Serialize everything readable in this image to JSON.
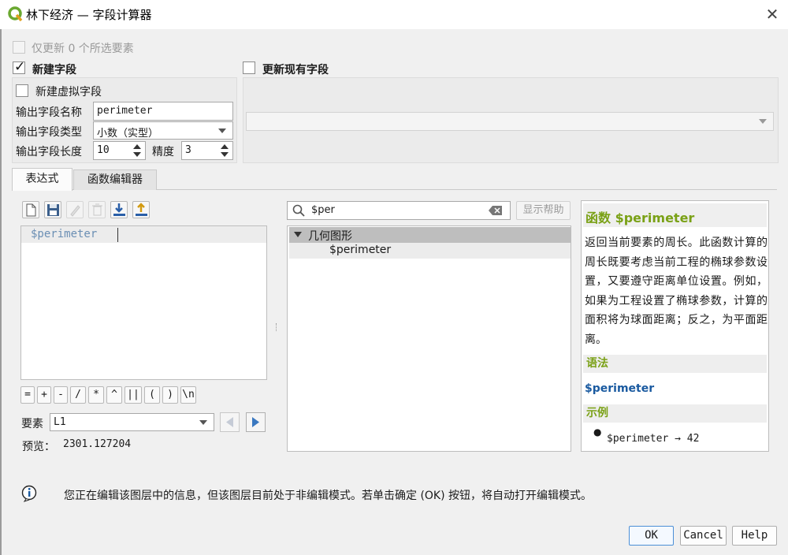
{
  "window": {
    "title": "林下经济 — 字段计算器",
    "close_label": "✕"
  },
  "only_update": {
    "label": "仅更新 0 个所选要素",
    "checked": false
  },
  "new_field": {
    "label": "新建字段",
    "checked": true,
    "virtual_label": "新建虚拟字段",
    "name_label": "输出字段名称",
    "name_value": "perimeter",
    "type_label": "输出字段类型",
    "type_value": "小数（实型）",
    "length_label": "输出字段长度",
    "length_value": "10",
    "precision_label": "精度",
    "precision_value": "3"
  },
  "update_existing": {
    "label": "更新现有字段",
    "checked": false,
    "combo_value": ""
  },
  "tabs": [
    {
      "label": "表达式",
      "active": true
    },
    {
      "label": "函数编辑器",
      "active": false
    }
  ],
  "toolbar": {
    "icons": [
      "new-file-icon",
      "save-icon",
      "edit-icon",
      "delete-icon",
      "import-icon",
      "export-icon"
    ]
  },
  "expression": {
    "text": "$perimeter"
  },
  "operators": [
    "=",
    "+",
    "-",
    "/",
    "*",
    "^",
    "||",
    "(",
    ")",
    "\\n"
  ],
  "feature": {
    "label": "要素",
    "value": "L1"
  },
  "preview": {
    "label": "预览：",
    "value": "2301.127204"
  },
  "search": {
    "value": "$per",
    "help_button": "显示帮助"
  },
  "tree": {
    "group": "几何图形",
    "item": "$perimeter"
  },
  "help": {
    "title_prefix": "函数",
    "title_func": "$perimeter",
    "description": "返回当前要素的周长。此函数计算的周长既要考虑当前工程的椭球参数设置，又要遵守距离单位设置。例如，如果为工程设置了椭球参数，计算的面积将为球面距离；反之，为平面距离。",
    "syntax_heading": "语法",
    "syntax": "$perimeter",
    "examples_heading": "示例",
    "example": "$perimeter → 42"
  },
  "info": {
    "text": "您正在编辑该图层中的信息，但该图层目前处于非编辑模式。若单击确定 (OK) 按钮，将自动打开编辑模式。"
  },
  "buttons": {
    "ok": "OK",
    "cancel": "Cancel",
    "help": "Help"
  },
  "colors": {
    "accent_green": "#7aa116",
    "link_blue": "#1a5aa0",
    "tree_highlight": "#bebebe"
  }
}
